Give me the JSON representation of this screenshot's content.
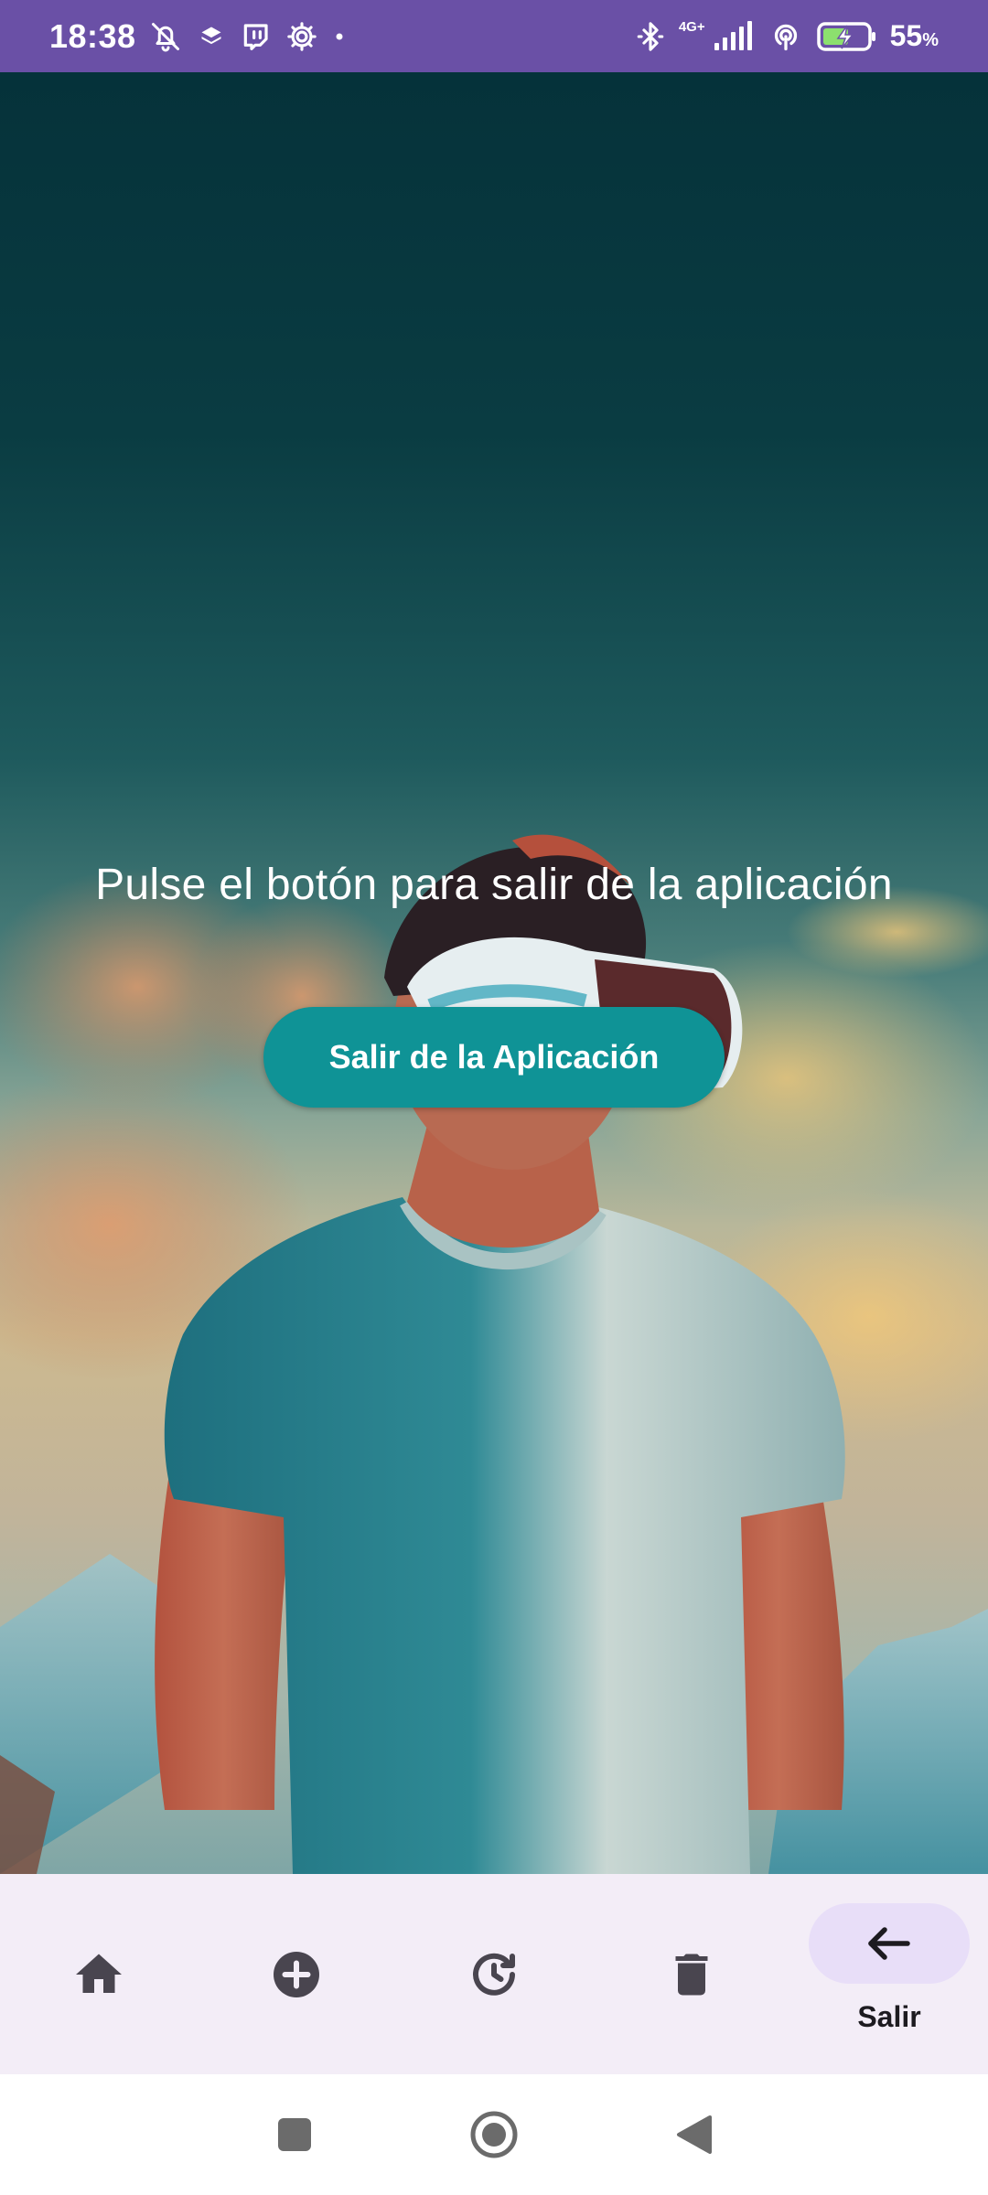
{
  "status_bar": {
    "time": "18:38",
    "network_type": "4G+",
    "battery_percent": "55",
    "battery_unit": "%",
    "icons_left": [
      "bell-off-icon",
      "layers-icon",
      "twitch-icon",
      "settings-gear-icon",
      "dot-icon"
    ],
    "icons_right": [
      "bluetooth-icon",
      "signal-icon",
      "hotspot-icon",
      "battery-charging-icon"
    ]
  },
  "main": {
    "prompt": "Pulse el botón para salir de la aplicación",
    "exit_button_label": "Salir de la Aplicación"
  },
  "bottom_nav": {
    "items": [
      {
        "icon": "home-icon",
        "label": ""
      },
      {
        "icon": "add-circle-icon",
        "label": ""
      },
      {
        "icon": "history-icon",
        "label": ""
      },
      {
        "icon": "trash-icon",
        "label": ""
      },
      {
        "icon": "arrow-back-icon",
        "label": "Salir",
        "active": true
      }
    ]
  },
  "system_nav": {
    "buttons": [
      "recents-button",
      "home-button",
      "back-button"
    ]
  },
  "colors": {
    "status_bar": "#6a50a6",
    "button": "#0f9396",
    "nav_background": "#f3edf7",
    "nav_indicator": "#e8def8",
    "nav_icon": "#49454f"
  }
}
